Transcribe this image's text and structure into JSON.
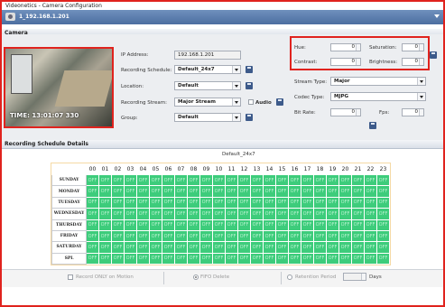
{
  "window": {
    "title": "Videonetics - Camera Configuration"
  },
  "camera_header": {
    "label": "1_192.168.1.201"
  },
  "sections": {
    "camera": "Camera",
    "schedule": "Recording Schedule Details"
  },
  "preview": {
    "timestamp": "TIME: 13:01:07 330"
  },
  "form": {
    "ip_label": "IP Address:",
    "ip_value": "192.168.1.201",
    "schedule_label": "Recording Schedule:",
    "schedule_value": "Default_24x7",
    "location_label": "Location:",
    "location_value": "Default",
    "stream_label": "Recording Stream:",
    "stream_value": "Major Stream",
    "audio_label": "Audio",
    "group_label": "Group:",
    "group_value": "Default"
  },
  "image": {
    "hue_label": "Hue:",
    "hue_value": "0",
    "saturation_label": "Saturation:",
    "saturation_value": "0",
    "contrast_label": "Contrast:",
    "contrast_value": "0",
    "brightness_label": "Brightness:",
    "brightness_value": "0"
  },
  "stream": {
    "stream_type_label": "Stream Type:",
    "stream_type_value": "Major",
    "codec_label": "Codec Type:",
    "codec_value": "MJPG",
    "bitrate_label": "Bit Rate:",
    "bitrate_value": "0",
    "fps_label": "Fps:",
    "fps_value": "0"
  },
  "schedule": {
    "name": "Default_24x7",
    "hours": [
      "00",
      "01",
      "02",
      "03",
      "04",
      "05",
      "06",
      "07",
      "08",
      "09",
      "10",
      "11",
      "12",
      "13",
      "14",
      "15",
      "16",
      "17",
      "18",
      "19",
      "20",
      "21",
      "22",
      "23"
    ],
    "days": [
      "SUNDAY",
      "MONDAY",
      "TUESDAY",
      "WEDNESDAY",
      "THURSDAY",
      "FRIDAY",
      "SATURDAY",
      "SPL"
    ],
    "cell_text": "OFF",
    "cell_color": "#3dcc7b"
  },
  "footer": {
    "record_motion_label": "Record ONLY on Motion",
    "fifo_label": "FIFO Delete",
    "retention_label": "Retention Period",
    "days_label": "Days"
  },
  "colors": {
    "accent": "#e0231e",
    "header": "#4c6ea0"
  }
}
